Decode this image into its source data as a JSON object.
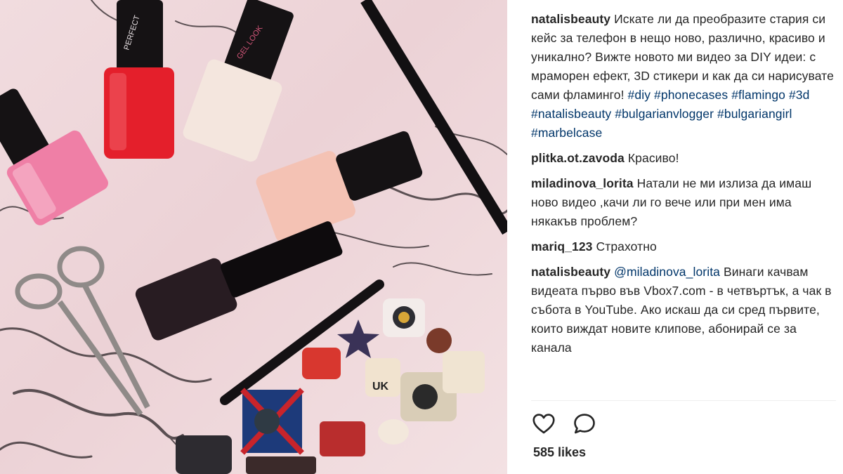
{
  "post": {
    "caption": {
      "user": "natalisbeauty",
      "text": "Искате ли да преобразите стария си кейс за телефон в нещо ново, различно, красиво и уникално? Вижте новото ми видео за DIY идеи: с мраморен ефект, 3D стикери и как да си нарисувате сами фламинго!",
      "hashtags": [
        "#diy",
        "#phonecases",
        "#flamingo",
        "#3d",
        "#natalisbeauty",
        "#bulgarianvlogger",
        "#bulgariangirl",
        "#marbelcase"
      ]
    },
    "comments": [
      {
        "user": "plitka.ot.zavoda",
        "text": "Красиво!"
      },
      {
        "user": "miladinova_lorita",
        "text": "Натали не ми излиза да имаш ново видео ,качи ли го вече или при мен има някакъв проблем?"
      },
      {
        "user": "mariq_123",
        "text": "Страхотно"
      },
      {
        "user": "natalisbeauty",
        "mention": "@miladinova_lorita",
        "text": "Винаги качвам видеата първо във Vbox7.com - в четвъртък, а чак в събота в YouTube. Ако искаш да си сред първите, които виждат новите клипове, абонирай се за канала"
      }
    ],
    "likes": "585 likes",
    "photo_labels": {
      "bottle1": "PERFECT",
      "bottle2": "GEL LOOK",
      "sticker": "UK"
    }
  }
}
